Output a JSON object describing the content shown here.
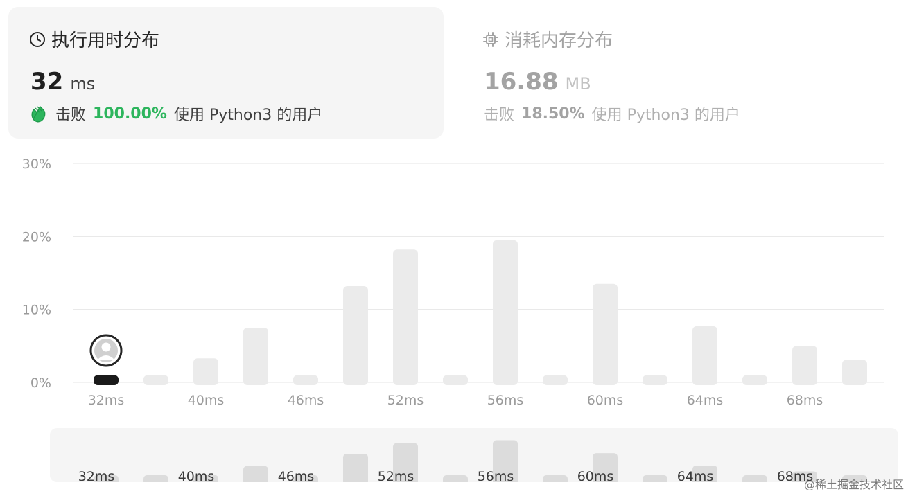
{
  "runtime": {
    "title": "执行用时分布",
    "value": "32",
    "unit": "ms",
    "beats_label": "击败",
    "beats_pct": "100.00%",
    "beats_suffix": "使用 Python3 的用户",
    "icon": "clock-icon",
    "accent": "#2db55d"
  },
  "memory": {
    "title": "消耗内存分布",
    "value": "16.88",
    "unit": "MB",
    "beats_label": "击败",
    "beats_pct": "18.50%",
    "beats_suffix": "使用 Python3 的用户",
    "icon": "chip-icon"
  },
  "chart_data": {
    "type": "bar",
    "y_ticks": [
      "30%",
      "20%",
      "10%",
      "0%"
    ],
    "ylim": [
      0,
      30
    ],
    "x_tick_labels": [
      "32ms",
      "40ms",
      "46ms",
      "52ms",
      "56ms",
      "60ms",
      "64ms",
      "68ms"
    ],
    "values": [
      1,
      1,
      3.3,
      7.5,
      1,
      13.2,
      18.2,
      1,
      19.5,
      1,
      13.5,
      1,
      7.7,
      1,
      5,
      3.1
    ],
    "highlight_index": 0,
    "bar_color": "#ebebeb",
    "highlight_color": "#1a1a1a",
    "grid": true
  },
  "overview": {
    "labels": [
      "32ms",
      "40ms",
      "46ms",
      "52ms",
      "56ms",
      "60ms",
      "64ms",
      "68ms"
    ]
  },
  "watermark": "@稀土掘金技术社区"
}
